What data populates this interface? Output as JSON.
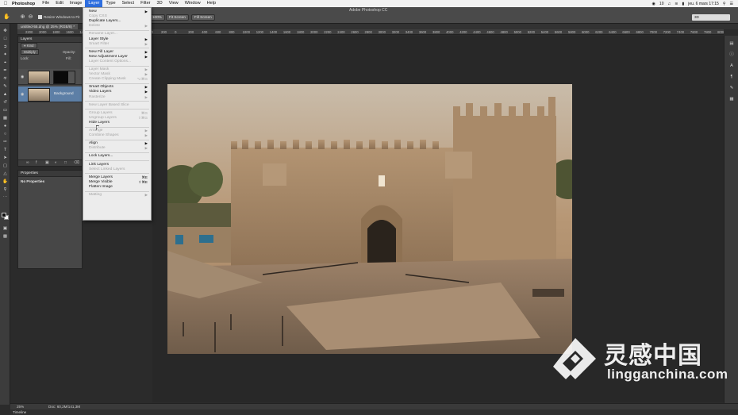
{
  "menubar": {
    "app_name": "Photoshop",
    "menus": [
      "File",
      "Edit",
      "Image",
      "Layer",
      "Type",
      "Select",
      "Filter",
      "3D",
      "View",
      "Window",
      "Help"
    ],
    "active_menu": "Layer",
    "status_icons": [
      "camera-icon",
      "speaker-icon",
      "wifi-icon",
      "battery-icon"
    ],
    "clock": "jeu. 6 mars 17:15",
    "badge": "10"
  },
  "options_bar": {
    "window_title": "Adobe Photoshop CC",
    "resize_checkbox_label": "Resize Windows to Fit",
    "zoom_button": "100%",
    "fit_screen_button": "Fit Screen",
    "fill_screen_button": "Fill Screen",
    "workspace": "3D"
  },
  "document": {
    "tab_title": "untitled-55.dng @ 25% (RGB/8) *",
    "ruler_labels": [
      "2200",
      "2000",
      "1800",
      "1600",
      "1400",
      "1200",
      "1000",
      "800",
      "600",
      "400",
      "200",
      "0",
      "200",
      "400",
      "600",
      "800",
      "1000",
      "1200",
      "1400",
      "1600",
      "1800",
      "2000",
      "2200",
      "2400",
      "2600",
      "2800",
      "3000",
      "3200",
      "3400",
      "3600",
      "3800",
      "4000",
      "4200",
      "4400",
      "4600",
      "4800",
      "5000",
      "5200",
      "5400",
      "5600",
      "5800",
      "6000",
      "6200",
      "6400",
      "6600",
      "6800",
      "7000",
      "7200",
      "7400",
      "7600",
      "7800",
      "8000",
      "8200"
    ]
  },
  "layers_panel": {
    "title": "Layers",
    "filter_kind": "Kind",
    "blend_mode": "Multiply",
    "opacity_label": "Opacity:",
    "lock_label": "Lock:",
    "fill_label": "Fill:",
    "layers": [
      {
        "name": "",
        "has_mask": true
      },
      {
        "name": "Background",
        "has_mask": false
      }
    ]
  },
  "properties_panel": {
    "title": "Properties",
    "content": "No Properties"
  },
  "layer_menu": {
    "items": [
      {
        "label": "New",
        "enabled": true,
        "submenu": true
      },
      {
        "label": "Copy CSS",
        "enabled": false
      },
      {
        "label": "Duplicate Layers...",
        "enabled": true
      },
      {
        "label": "Delete",
        "enabled": false,
        "submenu": true
      },
      {
        "separator": true
      },
      {
        "label": "Rename Layer...",
        "enabled": false
      },
      {
        "label": "Layer Style",
        "enabled": true,
        "submenu": true
      },
      {
        "label": "Smart Filter",
        "enabled": false,
        "submenu": true
      },
      {
        "separator": true
      },
      {
        "label": "New Fill Layer",
        "enabled": true,
        "submenu": true
      },
      {
        "label": "New Adjustment Layer",
        "enabled": true,
        "submenu": true
      },
      {
        "label": "Layer Content Options...",
        "enabled": false
      },
      {
        "separator": true
      },
      {
        "label": "Layer Mask",
        "enabled": false,
        "submenu": true
      },
      {
        "label": "Vector Mask",
        "enabled": false,
        "submenu": true
      },
      {
        "label": "Create Clipping Mask",
        "enabled": false,
        "shortcut": "⌥⌘G"
      },
      {
        "separator": true
      },
      {
        "label": "Smart Objects",
        "enabled": true,
        "submenu": true
      },
      {
        "label": "Video Layers",
        "enabled": true,
        "submenu": true
      },
      {
        "label": "Rasterize",
        "enabled": false,
        "submenu": true
      },
      {
        "separator": true
      },
      {
        "label": "New Layer Based Slice",
        "enabled": false
      },
      {
        "separator": true
      },
      {
        "label": "Group Layers",
        "enabled": false,
        "shortcut": "⌘G"
      },
      {
        "label": "Ungroup Layers",
        "enabled": false,
        "shortcut": "⇧⌘G"
      },
      {
        "label": "Hide Layers",
        "enabled": true
      },
      {
        "separator": true
      },
      {
        "label": "Arrange",
        "enabled": false,
        "submenu": true
      },
      {
        "label": "Combine Shapes",
        "enabled": false,
        "submenu": true
      },
      {
        "separator": true
      },
      {
        "label": "Align",
        "enabled": true,
        "submenu": true
      },
      {
        "label": "Distribute",
        "enabled": false,
        "submenu": true
      },
      {
        "separator": true
      },
      {
        "label": "Lock Layers...",
        "enabled": true
      },
      {
        "separator": true
      },
      {
        "label": "Link Layers",
        "enabled": true
      },
      {
        "label": "Select Linked Layers",
        "enabled": false
      },
      {
        "separator": true
      },
      {
        "label": "Merge Layers",
        "enabled": true,
        "shortcut": "⌘E"
      },
      {
        "label": "Merge Visible",
        "enabled": true,
        "shortcut": "⇧⌘E"
      },
      {
        "label": "Flatten Image",
        "enabled": true
      },
      {
        "separator": true
      },
      {
        "label": "Matting",
        "enabled": false,
        "submenu": true
      }
    ]
  },
  "statusbar": {
    "zoom": "25%",
    "doc_info": "Doc: 60,2M/141,3M"
  },
  "timeline": {
    "label": "Timeline"
  },
  "watermark": {
    "cn_text": "灵感中国",
    "url": "lingganchina.com"
  },
  "colors": {
    "menu_highlight": "#2f6fe0",
    "panel_bg": "#474747",
    "canvas_bg": "#282828",
    "photo_sky": "#c6b8a3",
    "photo_stone": "#a5886a"
  }
}
